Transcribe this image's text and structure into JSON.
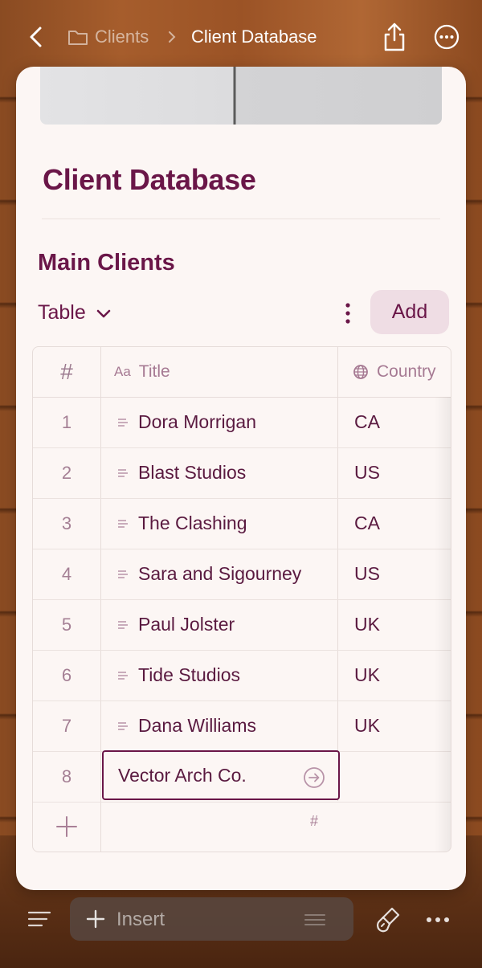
{
  "nav": {
    "breadcrumb_parent": "Clients",
    "breadcrumb_current": "Client Database"
  },
  "page": {
    "title": "Client Database"
  },
  "section": {
    "title": "Main Clients",
    "view_label": "Table",
    "add_label": "Add"
  },
  "table": {
    "columns": {
      "num": "#",
      "title_prefix": "Aa",
      "title": "Title",
      "country": "Country"
    },
    "rows": [
      {
        "num": "1",
        "title": "Dora Morrigan",
        "country": "CA"
      },
      {
        "num": "2",
        "title": "Blast Studios",
        "country": "US"
      },
      {
        "num": "3",
        "title": "The Clashing",
        "country": "CA"
      },
      {
        "num": "4",
        "title": "Sara and Sigourney",
        "country": "US"
      },
      {
        "num": "5",
        "title": "Paul Jolster",
        "country": "UK"
      },
      {
        "num": "6",
        "title": "Tide Studios",
        "country": "UK"
      },
      {
        "num": "7",
        "title": "Dana Williams",
        "country": "UK"
      }
    ],
    "editing_row": {
      "num": "8",
      "value": "Vector Arch Co."
    },
    "summary_symbol": "#"
  },
  "toolbar": {
    "insert_label": "Insert"
  },
  "colors": {
    "accent": "#6a1648",
    "card_bg": "#fcf6f4",
    "add_button_bg": "#efdde4"
  },
  "icons": [
    "back-icon",
    "folder-icon",
    "chevron-right-icon",
    "share-icon",
    "more-circle-icon",
    "chevron-down-icon",
    "kebab-icon",
    "globe-icon",
    "row-lines-icon",
    "open-arrow-icon",
    "plus-icon",
    "outline-icon",
    "brush-icon",
    "more-dots-icon"
  ]
}
